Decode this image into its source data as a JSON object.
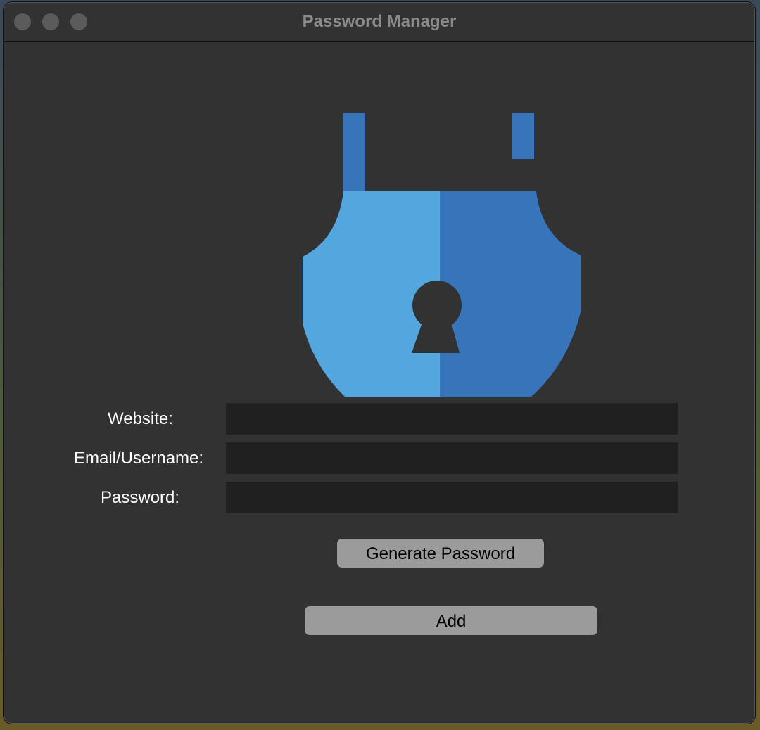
{
  "window": {
    "title": "Password Manager"
  },
  "logo": {
    "icon": "padlock-icon",
    "colors": {
      "light_blue": "#53a6de",
      "dark_blue": "#3874b9",
      "keyhole": "#323232"
    }
  },
  "form": {
    "website_label": "Website:",
    "website_value": "",
    "email_label": "Email/Username:",
    "email_value": "",
    "password_label": "Password:",
    "password_value": ""
  },
  "buttons": {
    "generate_label": "Generate Password",
    "add_label": "Add"
  },
  "colors": {
    "window_bg": "#323232",
    "field_bg": "#202020",
    "button_bg": "#9b9b9b",
    "label_text": "#ffffff"
  }
}
